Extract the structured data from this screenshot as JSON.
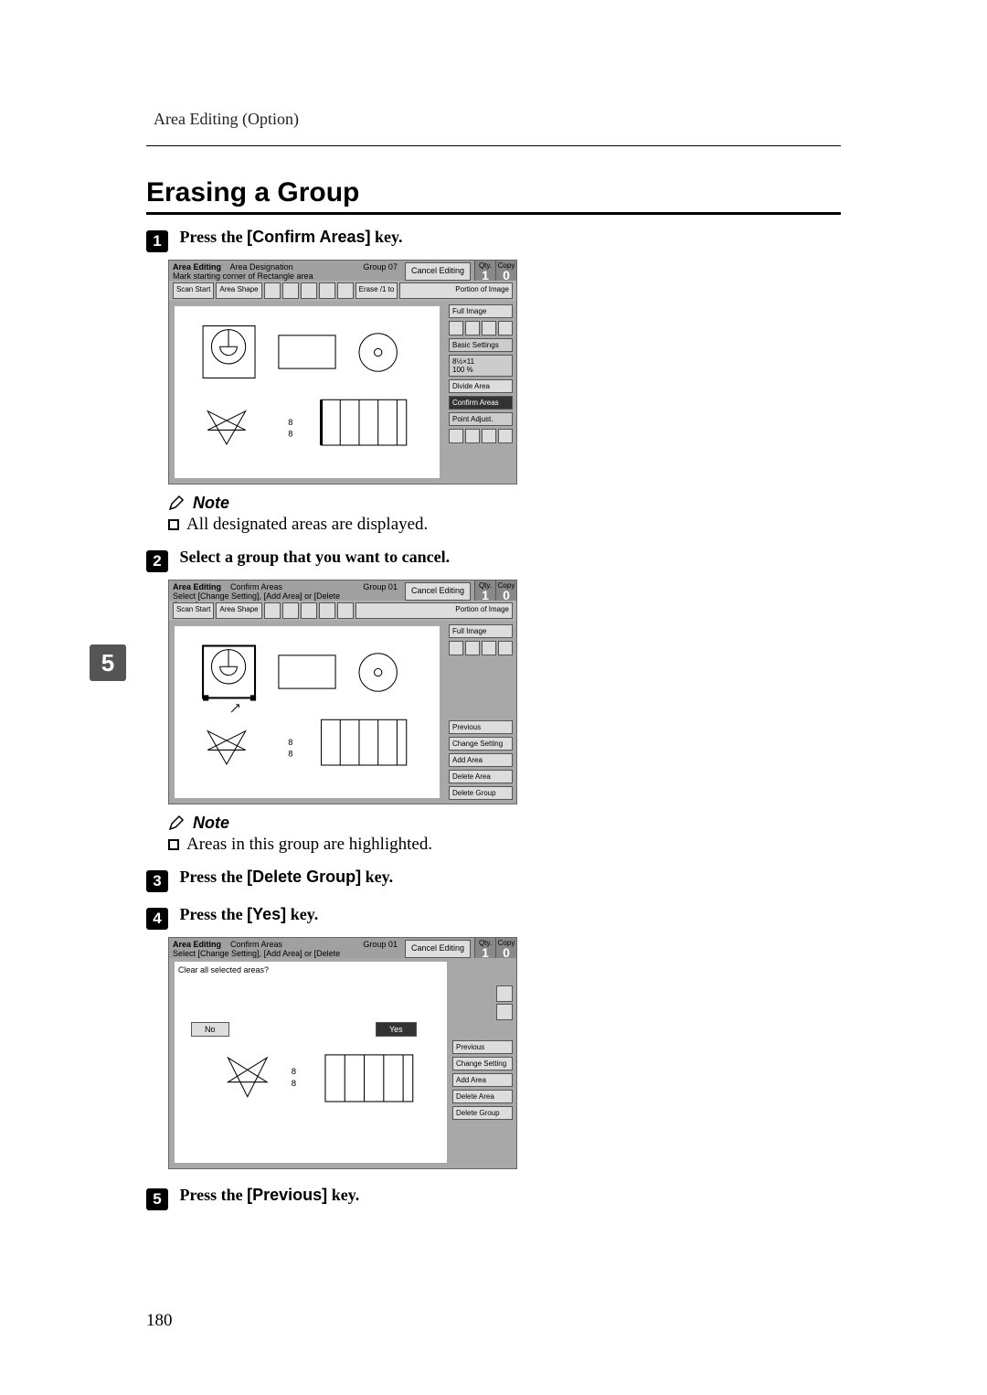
{
  "header": {
    "breadcrumb": "Area Editing (Option)"
  },
  "section": {
    "title": "Erasing a Group"
  },
  "chapter_tab": "5",
  "page_number": "180",
  "steps": {
    "s1": {
      "prefix": "Press the ",
      "key": "[Confirm Areas]",
      "suffix": " key."
    },
    "s2": {
      "text": "Select a group that you want to cancel."
    },
    "s3": {
      "prefix": "Press the ",
      "key": "[Delete Group]",
      "suffix": " key."
    },
    "s4": {
      "prefix": "Press the ",
      "key": "[Yes]",
      "suffix": " key."
    },
    "s5": {
      "prefix": "Press the ",
      "key": "[Previous]",
      "suffix": " key."
    }
  },
  "notes": {
    "label": "Note",
    "n1": "All designated areas are displayed.",
    "n2": "Areas in this group are highlighted."
  },
  "screenshot_common": {
    "app_title": "Area Editing",
    "cancel_editing": "Cancel Editing",
    "scan_start": "Scan Start",
    "area_shape": "Area Shape",
    "qty_label": "Qty.",
    "qty_value": "1",
    "copy_label": "Copy",
    "copy_value": "0",
    "portion_of_image": "Portion of Image",
    "full_image": "Full Image"
  },
  "screenshot1": {
    "mode_line": "Area Designation",
    "hint_line": "Mark starting corner of Rectangle area",
    "group_label": "Group 07",
    "toolbar_extra": "Erase /1 to",
    "basic_settings": "Basic Settings",
    "ratio_line": "8½×11",
    "pct_line": "100 %",
    "divide_area": "Divide Area",
    "confirm_areas": "Confirm Areas",
    "point_adjust": "Point Adjust."
  },
  "screenshot2": {
    "mode_line": "Confirm Areas",
    "hint_line": "Select [Change Setting], [Add Area] or [Delete Group]",
    "group_label": "Group 01",
    "previous": "Previous",
    "change_setting": "Change Setting",
    "add_area": "Add Area",
    "delete_area": "Delete Area",
    "delete_group": "Delete Group"
  },
  "screenshot3": {
    "mode_line": "Confirm Areas",
    "hint_line": "Select [Change Setting], [Add Area] or [Delete Group]",
    "group_label": "Group 01",
    "dialog_text": "Clear all selected areas?",
    "no": "No",
    "yes": "Yes",
    "previous": "Previous",
    "change_setting": "Change Setting",
    "add_area": "Add Area",
    "delete_area": "Delete Area",
    "delete_group": "Delete Group"
  }
}
